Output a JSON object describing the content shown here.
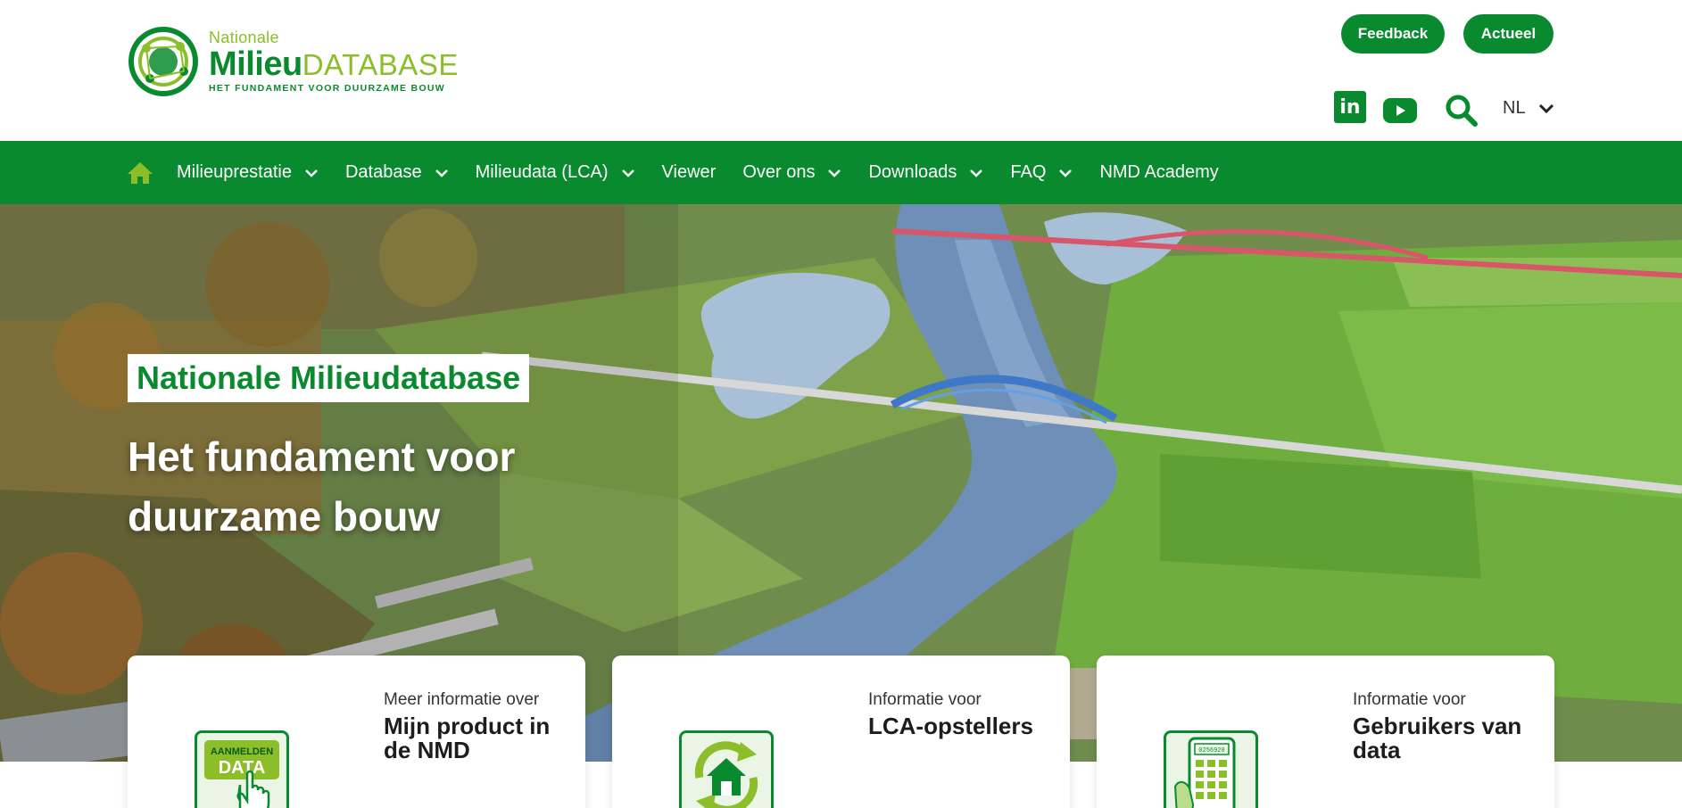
{
  "brand": {
    "small": "Nationale",
    "big": "Milieu",
    "big_suffix": "DATABASE",
    "tagline": "HET FUNDAMENT VOOR DUURZAME BOUW",
    "primary_color": "#0a8a2e",
    "accent_color": "#8cbe2a"
  },
  "header": {
    "feedback_label": "Feedback",
    "actueel_label": "Actueel",
    "linkedin_glyph": "in",
    "language": "NL"
  },
  "nav": {
    "items": [
      {
        "label": "Milieuprestatie",
        "dropdown": true
      },
      {
        "label": "Database",
        "dropdown": true
      },
      {
        "label": "Milieudata (LCA)",
        "dropdown": true
      },
      {
        "label": "Viewer",
        "dropdown": false
      },
      {
        "label": "Over ons",
        "dropdown": true
      },
      {
        "label": "Downloads",
        "dropdown": true
      },
      {
        "label": "FAQ",
        "dropdown": true
      },
      {
        "label": "NMD Academy",
        "dropdown": false
      }
    ]
  },
  "hero": {
    "title": "Nationale Milieudatabase",
    "subtitle": "Het fundament voor duurzame bouw"
  },
  "cards": [
    {
      "pre": "Meer informatie over",
      "title": "Mijn product in de NMD",
      "icon": "aanmelden-data-icon",
      "icon_text_top": "AANMELDEN",
      "icon_text_big": "DATA"
    },
    {
      "pre": "Informatie voor",
      "title": "LCA-opstellers",
      "icon": "recycle-house-icon"
    },
    {
      "pre": "Informatie voor",
      "title": "Gebruikers van data",
      "icon": "calculator-hand-icon",
      "icon_text_top": "0256920"
    }
  ]
}
